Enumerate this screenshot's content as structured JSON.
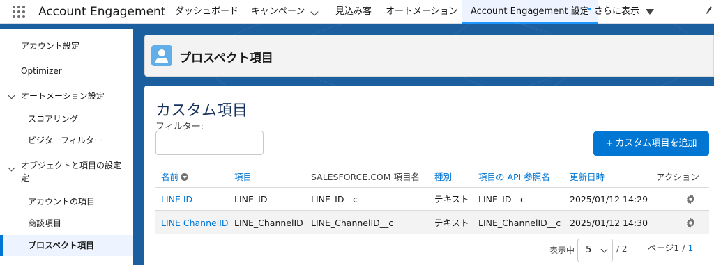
{
  "topnav": {
    "app_name": "Account Engagement",
    "items": [
      "ダッシュボード",
      "キャンペーン",
      "見込み客",
      "オートメーション",
      "Account Engagement 設定",
      "さらに表示"
    ]
  },
  "sidebar": {
    "items": [
      "アカウント設定",
      "Optimizer",
      "オートメーション設定",
      "スコアリング",
      "ビジターフィルター",
      "オブジェクトと項目の設定",
      "定",
      "アカウントの項目",
      "商談項目",
      "プロスペクト項目"
    ]
  },
  "header": {
    "title": "プロスペクト項目"
  },
  "main": {
    "title": "カスタム項目",
    "filter_label": "フィルター:",
    "filter_value": "",
    "add_button": "カスタム項目を追加"
  },
  "table": {
    "headers": [
      "名前",
      "項目",
      "SALESFORCE.COM 項目名",
      "種別",
      "項目の API 参照名",
      "更新日時",
      "アクション"
    ],
    "rows": [
      [
        "LINE ID",
        "LINE_ID",
        "LINE_ID__c",
        "テキスト",
        "LINE_ID__c",
        "2025/01/12 14:29"
      ],
      [
        "LINE ChannelID",
        "LINE_ChannelID",
        "LINE_ChannelID__c",
        "テキスト",
        "LINE_ChannelID__c",
        "2025/01/12 14:30"
      ]
    ]
  },
  "pagination": {
    "per_page_label": "表示中",
    "per_page_value": "5",
    "total": "/ 2",
    "page_label": "ページ",
    "page_current": "1",
    "page_sep": " / ",
    "page_total": "1"
  },
  "colors": {
    "brand_blue": "#0176d3",
    "title_navy": "#16325c",
    "background": "#1b5f9e"
  }
}
